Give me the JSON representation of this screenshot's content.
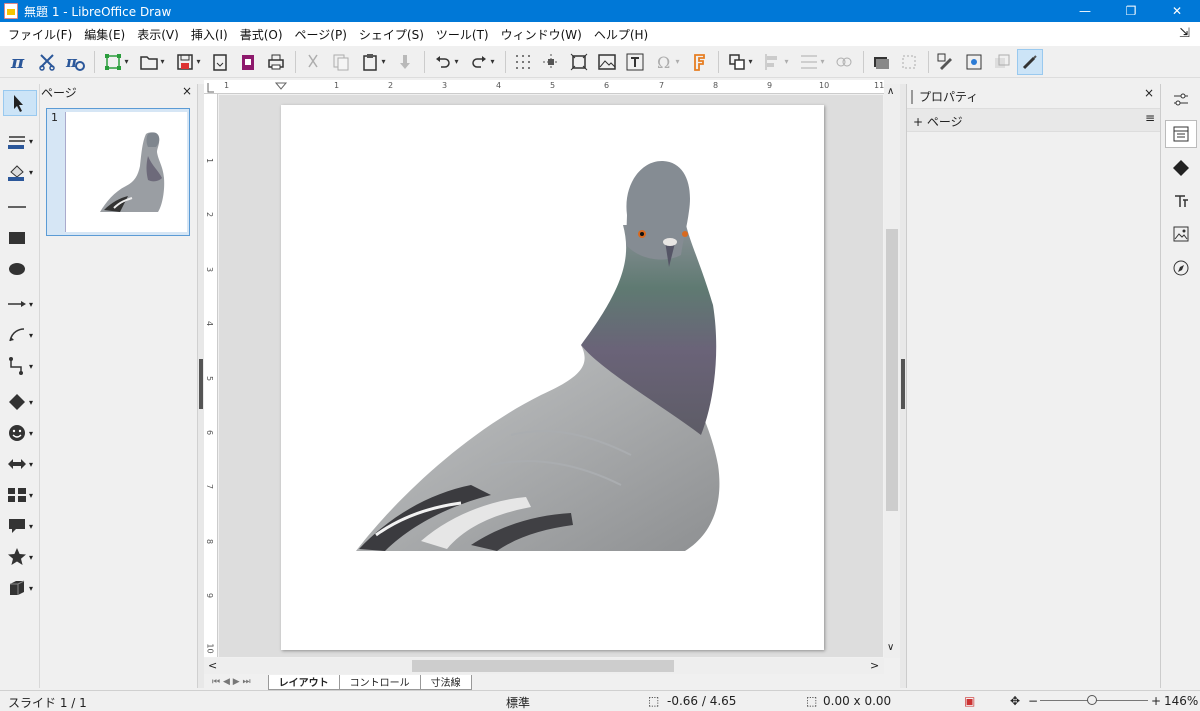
{
  "window": {
    "title": "無題 1 - LibreOffice Draw",
    "buttons": {
      "minimize": "—",
      "restore": "❐",
      "close": "✕"
    }
  },
  "menu": {
    "items": [
      "ファイル(F)",
      "編集(E)",
      "表示(V)",
      "挿入(I)",
      "書式(O)",
      "ページ(P)",
      "シェイプ(S)",
      "ツール(T)",
      "ウィンドウ(W)",
      "ヘルプ(H)"
    ],
    "end_icon": "tunnel-pin-icon"
  },
  "toolbar": {
    "icons": [
      "formula-icon",
      "cut-tool-icon",
      "clear-formatting-icon",
      "transform-icon",
      "open-icon",
      "save-icon",
      "export-icon",
      "export-pdf-icon",
      "print-icon",
      "cut-icon",
      "copy-icon",
      "paste-icon",
      "clone-format-icon",
      "undo-icon",
      "redo-icon",
      "grid-icon",
      "helplines-icon",
      "zoom-page-icon",
      "insert-image-icon",
      "insert-textbox-icon",
      "special-character-icon",
      "fontwork-icon",
      "transformations-icon",
      "align-icon",
      "distribute-icon",
      "arrange-icon",
      "shadow-icon",
      "crop-icon",
      "toggle-extrusion-icon",
      "points-icon",
      "glue-icon",
      "line-color-icon"
    ]
  },
  "left_tools": [
    "select-icon",
    "line-color-icon",
    "fill-color-icon",
    "line-icon",
    "rectangle-icon",
    "ellipse-icon",
    "lines-arrows-icon",
    "curves-icon",
    "connectors-icon",
    "basic-shapes-icon",
    "symbol-shapes-icon",
    "block-arrows-icon",
    "flowchart-icon",
    "callouts-icon",
    "stars-icon",
    "3d-objects-icon"
  ],
  "pages_panel": {
    "title": "ページ",
    "close": "×",
    "pages": [
      {
        "number": "1"
      }
    ]
  },
  "rulers": {
    "horizontal": [
      "1",
      "1",
      "2",
      "3",
      "4",
      "5",
      "6",
      "7",
      "8",
      "9",
      "10",
      "11"
    ],
    "vertical": [
      "1",
      "2",
      "3",
      "4",
      "5",
      "6",
      "7",
      "8",
      "9",
      "10"
    ]
  },
  "layer_tabs": [
    {
      "label": "レイアウト",
      "active": true
    },
    {
      "label": "コントロール",
      "active": false
    },
    {
      "label": "寸法線",
      "active": false
    }
  ],
  "tab_nav": "⏮ ◀ ▶ ⏭",
  "properties_panel": {
    "title": "プロパティ",
    "close": "×",
    "section": "ページ",
    "section_expand": "+",
    "section_menu": "≡"
  },
  "sidebar_deck": [
    "properties-icon",
    "styles-icon",
    "gallery-icon",
    "navigator-icon",
    "shapes-icon",
    "image-icon",
    "compass-icon"
  ],
  "status": {
    "slide": "スライド 1 / 1",
    "style": "標準",
    "position": "-0.66 / 4.65",
    "size": "0.00 x 0.00",
    "zoom": "146%",
    "zoom_level": 0.48
  },
  "colors": {
    "titlebar": "#0078d7",
    "accent": "#2b579a",
    "canvas": "#dddddd"
  }
}
